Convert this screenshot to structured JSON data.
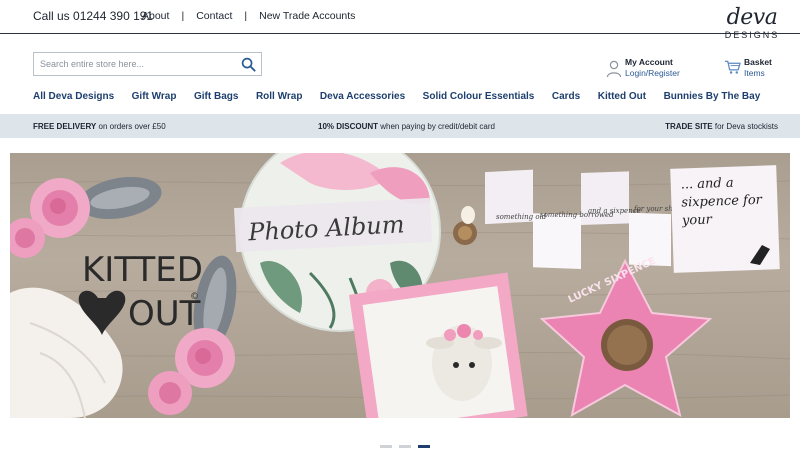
{
  "topbar": {
    "phone": "Call us 01244 390 191",
    "links": [
      "About",
      "Contact",
      "New Trade Accounts"
    ],
    "separator": "|"
  },
  "logo": {
    "script": "deva",
    "sub": "DESIGNS"
  },
  "search": {
    "placeholder": "Search entire store here...",
    "icon": "search-icon"
  },
  "account": {
    "title": "My Account",
    "link": "Login/Register",
    "icon": "user-icon"
  },
  "basket": {
    "title": "Basket",
    "link": "Items",
    "icon": "cart-icon"
  },
  "nav": [
    "All Deva Designs",
    "Gift Wrap",
    "Gift Bags",
    "Roll Wrap",
    "Deva Accessories",
    "Solid Colour Essentials",
    "Cards",
    "Kitted Out",
    "Bunnies By The Bay"
  ],
  "promo": [
    {
      "bold": "FREE DELIVERY",
      "rest": " on orders over £50"
    },
    {
      "bold": "10% DISCOUNT",
      "rest": " when paying by credit/debit card"
    },
    {
      "bold": "TRADE SITE",
      "rest": " for Deva stockists"
    }
  ],
  "hero": {
    "brand_line1": "KITTED",
    "brand_line2": "OUT",
    "copyright": "©",
    "album_title": "Photo Album",
    "fold_pages": [
      "something old",
      "something borrowed",
      "and a sixpence",
      "for your shoe"
    ],
    "card_text": "... and a sixpence for your",
    "star_text": "LUCKY SIXPENCE"
  },
  "carousel": {
    "slides": 3,
    "active": 3
  },
  "colors": {
    "nav": "#1e3f6e",
    "promo_bg": "#dde4ea",
    "pink": "#e887b4",
    "wood": "#ad a192"
  }
}
